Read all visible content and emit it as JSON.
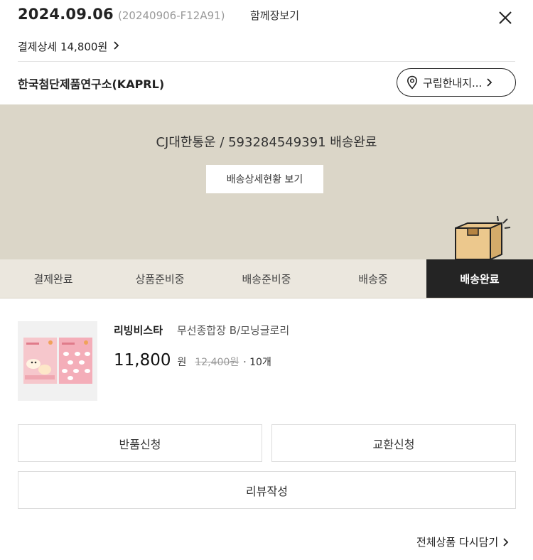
{
  "header": {
    "order_date": "2024.09.06",
    "order_id": "(20240906-F12A91)",
    "share_label": "함께장보기",
    "payment_detail_label": "결제상세 14,800원",
    "close_icon": "close-icon",
    "chevron_icon": "chevron-right-icon"
  },
  "seller": {
    "name": "한국첨단제품연구소(KAPRL)",
    "guide_label": "구립한내지...",
    "pin_icon": "location-pin-icon"
  },
  "delivery": {
    "tracking_text": "CJ대한통운 / 593284549391 배송완료",
    "track_button_label": "배송상세현황 보기",
    "illustration": "parcel-box-icon",
    "panel_color": "#dbd6c8"
  },
  "steps": [
    {
      "label": "결제완료",
      "active": false
    },
    {
      "label": "상품준비중",
      "active": false
    },
    {
      "label": "배송준비중",
      "active": false
    },
    {
      "label": "배송중",
      "active": false
    },
    {
      "label": "배송완료",
      "active": true
    }
  ],
  "product": {
    "brand": "리빙비스타",
    "name": "무선종합장 B/모닝글로리",
    "price": "11,800",
    "currency": "원",
    "original_price": "12,400원",
    "quantity": "· 10개"
  },
  "actions": {
    "return_label": "반품신청",
    "exchange_label": "교환신청",
    "review_label": "리뷰작성"
  },
  "footer": {
    "readd_label": "전체상품 다시담기"
  },
  "colors": {
    "active_step_bg": "#242424",
    "step_bg": "#ebe7de",
    "accent_text": "#222222"
  }
}
